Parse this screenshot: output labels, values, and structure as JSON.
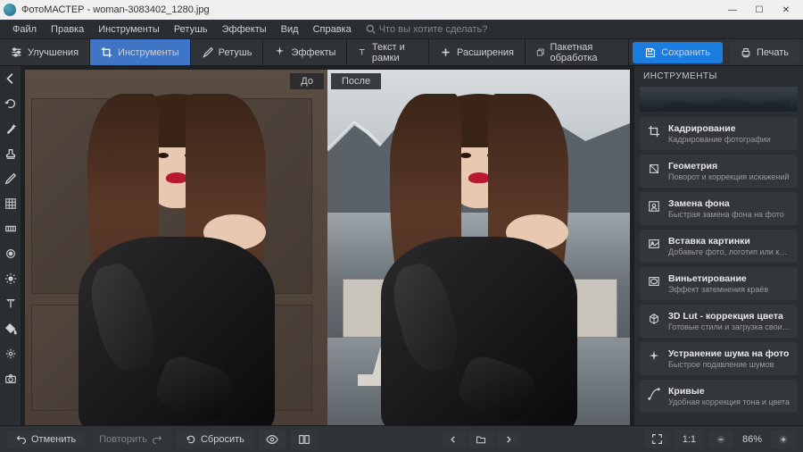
{
  "titlebar": {
    "app": "ФотоМАСТЕР",
    "filename": "woman-3083402_1280.jpg"
  },
  "menu": [
    "Файл",
    "Правка",
    "Инструменты",
    "Ретушь",
    "Эффекты",
    "Вид",
    "Справка"
  ],
  "menu_search_placeholder": "Что вы хотите сделать?",
  "toolbar": [
    {
      "label": "Улучшения",
      "icon": "sliders"
    },
    {
      "label": "Инструменты",
      "icon": "crop",
      "active": true
    },
    {
      "label": "Ретушь",
      "icon": "brush"
    },
    {
      "label": "Эффекты",
      "icon": "sparkle"
    },
    {
      "label": "Текст и рамки",
      "icon": "text"
    },
    {
      "label": "Расширения",
      "icon": "plus"
    },
    {
      "label": "Пакетная обработка",
      "icon": "stack"
    }
  ],
  "toolbar_right": {
    "save": "Сохранить",
    "print": "Печать"
  },
  "compare": {
    "before": "До",
    "after": "После"
  },
  "right": {
    "header": "ИНСТРУМЕНТЫ",
    "tools": [
      {
        "title": "Кадрирование",
        "desc": "Кадрирование фотографии",
        "icon": "crop"
      },
      {
        "title": "Геометрия",
        "desc": "Поворот и коррекция искажений",
        "icon": "geometry"
      },
      {
        "title": "Замена фона",
        "desc": "Быстрая замена фона на фото",
        "icon": "bgreplace"
      },
      {
        "title": "Вставка картинки",
        "desc": "Добавьте фото, логотип или клипарт",
        "icon": "insertimg"
      },
      {
        "title": "Виньетирование",
        "desc": "Эффект затемнения краёв",
        "icon": "vignette"
      },
      {
        "title": "3D Lut - коррекция цвета",
        "desc": "Готовые стили и загрузка своих пресетов",
        "icon": "lut"
      },
      {
        "title": "Устранение шума на фото",
        "desc": "Быстрое подавление шумов",
        "icon": "denoise"
      },
      {
        "title": "Кривые",
        "desc": "Удобная коррекция тона и цвета",
        "icon": "curves"
      }
    ]
  },
  "bottom": {
    "undo": "Отменить",
    "redo": "Повторить",
    "reset": "Сбросить",
    "zoom_ratio": "1:1",
    "zoom_pct": "86%"
  }
}
